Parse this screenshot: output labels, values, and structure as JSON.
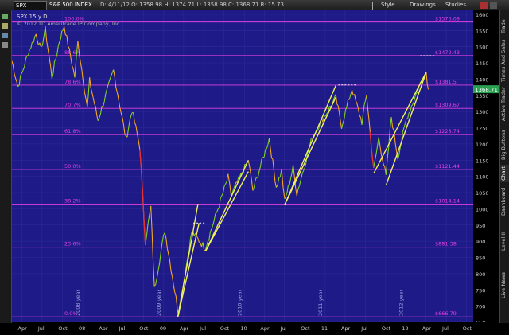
{
  "toolbar": {
    "symbol": "SPX",
    "index_name": "S&P 500 INDEX",
    "stats": "D: 4/11/12  O: 1358.98  H: 1374.71  L: 1358.98  C: 1368.71  R: 15.73",
    "style_label": "Style",
    "drawings_label": "Drawings",
    "studies_label": "Studies"
  },
  "chart_header": {
    "line1": "SPX 15 y D",
    "copyright": "© 2012 TD Ameritrade IP Company, Inc."
  },
  "right_tabs": [
    "Trade",
    "Times And Sales",
    "Active Trader",
    "Big Buttons",
    "Chart",
    "Dashboard",
    "Level II",
    "Live News"
  ],
  "left_icons": [
    "tool-a-icon",
    "tool-b-icon",
    "tool-c-icon",
    "tool-d-icon"
  ],
  "colors": {
    "plot_bg": "#1e1a88",
    "fib": "#e040e0",
    "trend": "#f0f060",
    "price_tag": "#2aa050"
  },
  "fib_levels": [
    {
      "pct": "100.0%",
      "price": "$1576.09",
      "value": 1576.09
    },
    {
      "pct": "88.6%",
      "price": "$1472.43",
      "value": 1472.43
    },
    {
      "pct": "78.6%",
      "price": "$1381.5",
      "value": 1381.5
    },
    {
      "pct": "70.7%",
      "price": "$1309.67",
      "value": 1309.67
    },
    {
      "pct": "61.8%",
      "price": "$1228.74",
      "value": 1228.74
    },
    {
      "pct": "50.0%",
      "price": "$1121.44",
      "value": 1121.44
    },
    {
      "pct": "38.2%",
      "price": "$1014.14",
      "value": 1014.14
    },
    {
      "pct": "23.6%",
      "price": "$881.38",
      "value": 881.38
    },
    {
      "pct": "0.0%",
      "price": "$666.79",
      "value": 666.79
    }
  ],
  "y_ticks": [
    1600,
    1550,
    1500,
    1450,
    1400,
    1350,
    1300,
    1250,
    1200,
    1150,
    1100,
    1050,
    1000,
    950,
    900,
    850,
    800,
    750,
    700,
    650
  ],
  "y_range": [
    650,
    1612
  ],
  "last_price": "1368.71",
  "last_value": 1368.71,
  "x_ticks": [
    "Apr",
    "Jul",
    "Oct",
    "08",
    "Apr",
    "Jul",
    "Oct",
    "09",
    "Apr",
    "Jul",
    "Oct",
    "10",
    "Apr",
    "Jul",
    "Oct",
    "11",
    "Apr",
    "Jul",
    "Oct",
    "12",
    "Apr",
    "Jul",
    "Oct"
  ],
  "year_labels": [
    "2008 year",
    "2009 year",
    "2010 year",
    "2011 year",
    "2012 year"
  ],
  "trendlines": [
    {
      "x1": "2009-03-06",
      "y1": 667,
      "x2": "2009-06-10",
      "y2": 956
    },
    {
      "x1": "2009-03-06",
      "y1": 667,
      "x2": "2009-06-05",
      "y2": 1015
    },
    {
      "x1": "2009-07-10",
      "y1": 870,
      "x2": "2010-01-19",
      "y2": 1150
    },
    {
      "x1": "2009-07-10",
      "y1": 870,
      "x2": "2010-01-19",
      "y2": 1115
    },
    {
      "x1": "2010-07-01",
      "y1": 1011,
      "x2": "2011-02-18",
      "y2": 1344
    },
    {
      "x1": "2010-07-01",
      "y1": 1011,
      "x2": "2011-02-18",
      "y2": 1380
    },
    {
      "x1": "2011-08-09",
      "y1": 1110,
      "x2": "2012-04-02",
      "y2": 1422
    },
    {
      "x1": "2011-10-04",
      "y1": 1074,
      "x2": "2012-04-02",
      "y2": 1422
    }
  ]
}
